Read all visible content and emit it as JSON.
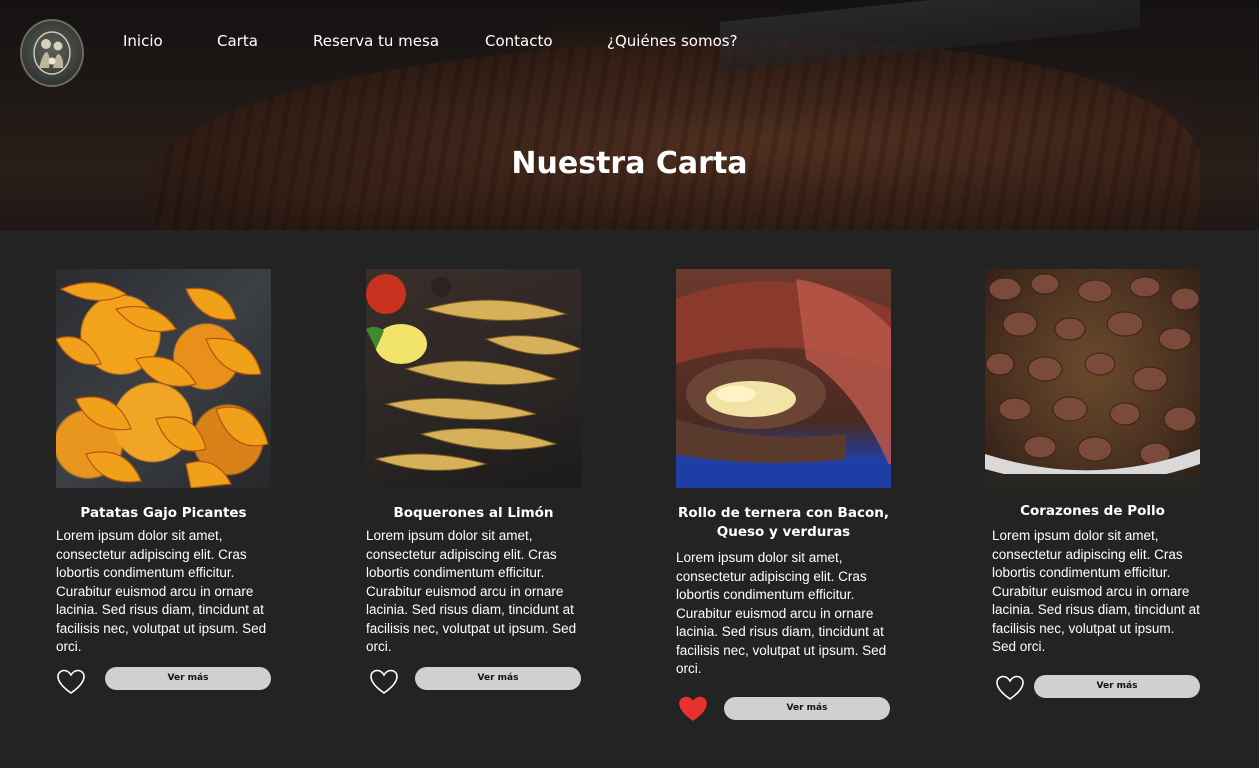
{
  "nav": {
    "items": [
      {
        "label": "Inicio"
      },
      {
        "label": "Carta"
      },
      {
        "label": "Reserva tu mesa"
      },
      {
        "label": "Contacto"
      },
      {
        "label": "¿Quiénes somos?"
      }
    ]
  },
  "hero": {
    "title": "Nuestra Carta"
  },
  "menu": {
    "items": [
      {
        "title": "Patatas Gajo Picantes",
        "description": "Lorem ipsum dolor sit amet, consectetur adipiscing elit. Cras lobortis condimentum efficitur. Curabitur euismod arcu in ornare lacinia. Sed risus diam, tincidunt at facilisis nec, volutpat ut ipsum. Sed orci.",
        "button": "Ver más",
        "favorite": false
      },
      {
        "title": "Boquerones al Limón",
        "description": "Lorem ipsum dolor sit amet, consectetur adipiscing elit. Cras lobortis condimentum efficitur. Curabitur euismod arcu in ornare lacinia. Sed risus diam, tincidunt at facilisis nec, volutpat ut ipsum. Sed orci.",
        "button": "Ver más",
        "favorite": false
      },
      {
        "title": "Rollo de ternera con Bacon, Queso y verduras",
        "description": "Lorem ipsum dolor sit amet, consectetur adipiscing elit. Cras lobortis condimentum efficitur. Curabitur euismod arcu in ornare lacinia. Sed risus diam, tincidunt at facilisis nec, volutpat ut ipsum. Sed orci.",
        "button": "Ver más",
        "favorite": true
      },
      {
        "title": "Corazones de Pollo",
        "description": "Lorem ipsum dolor sit amet, consectetur adipiscing elit. Cras lobortis condimentum efficitur. Curabitur euismod arcu in ornare lacinia. Sed risus diam, tincidunt at facilisis nec, volutpat ut ipsum. Sed orci.",
        "button": "Ver más",
        "favorite": false
      }
    ]
  },
  "colors": {
    "background": "#232323",
    "button": "#d0d0d0",
    "heart_active": "#e8312c",
    "heart_outline": "#ffffff"
  },
  "icons": {
    "logo": "family-logo",
    "favorite": "heart-icon"
  }
}
